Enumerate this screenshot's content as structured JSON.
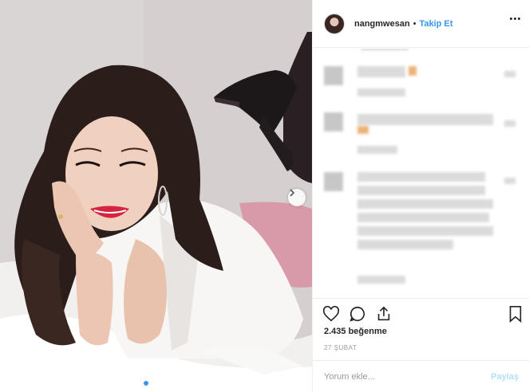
{
  "post": {
    "username": "nangmwesan",
    "separator": "•",
    "follow_label": "Takip Et",
    "likes_text": "2.435 beğenme",
    "date_text": "27 ŞUBAT",
    "photo_index": 2,
    "photo_count": 3
  },
  "comment_form": {
    "placeholder": "Yorum ekle...",
    "post_label": "Paylaş"
  },
  "icons": {
    "more": "more-horizontal-icon",
    "like": "heart-icon",
    "comment": "comment-bubble-icon",
    "share": "share-icon",
    "save": "bookmark-icon",
    "next": "chevron-right-icon"
  },
  "colors": {
    "accent": "#3897f0",
    "post_disabled": "#b2dffc",
    "text": "#262626",
    "muted": "#999999"
  }
}
